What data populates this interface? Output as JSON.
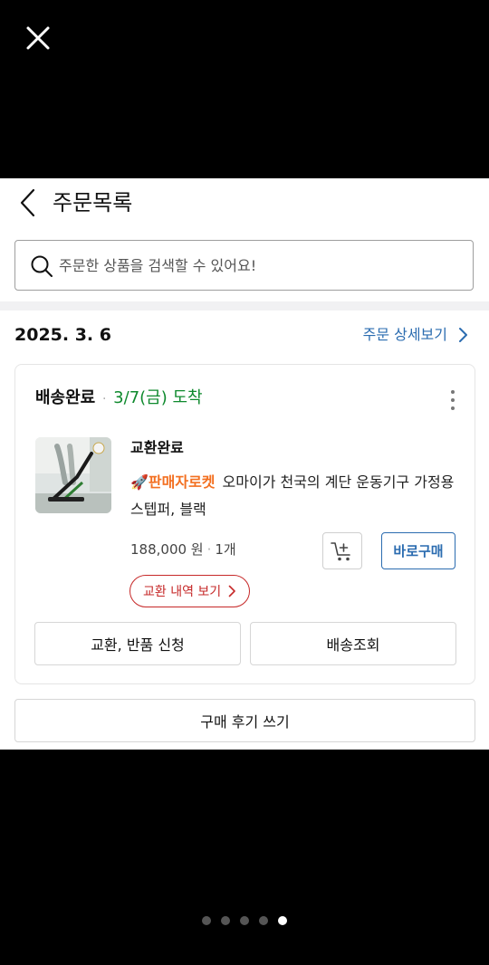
{
  "viewer": {
    "close_icon": "close-icon"
  },
  "header": {
    "title": "주문목록",
    "back_icon": "chevron-left-icon"
  },
  "search": {
    "placeholder": "주문한 상품을 검색할 수 있어요!",
    "icon": "search-icon"
  },
  "order": {
    "date": "2025. 3. 6",
    "detail_link": "주문 상세보기",
    "shipment": {
      "status": "배송완료",
      "separator": "·",
      "arrival": "3/7(금) 도착",
      "arrival_color": "#0f8a2e",
      "product": {
        "status": "교환완료",
        "badge": "🚀판매자로켓",
        "badge_color": "#f37021",
        "name": "오마이가 천국의 계단 운동기구 가정용 스텝퍼, 블랙",
        "price": "188,000 원",
        "separator": "·",
        "quantity": "1개"
      },
      "cart_icon": "add-to-cart-icon",
      "buy_now_label": "바로구매",
      "exchange_history_label": "교환 내역 보기",
      "return_button_label": "교환, 반품 신청",
      "tracking_button_label": "배송조회"
    },
    "review_button_label": "구매 후기 쓰기"
  },
  "pagination": {
    "total": 5,
    "active_index": 4
  },
  "colors": {
    "link_blue": "#2b6cb0",
    "exchange_red": "#c62828"
  }
}
